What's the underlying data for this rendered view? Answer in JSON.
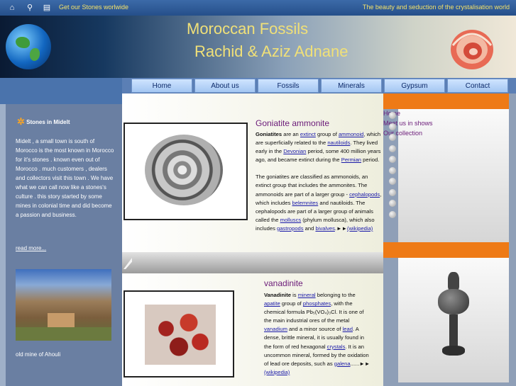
{
  "topbar": {
    "icons": [
      "home-icon",
      "search-icon",
      "document-icon"
    ],
    "tagline_left": "Get our Stones worlwide",
    "tagline_right": "The beauty and seduction of the crystalisation world"
  },
  "banner": {
    "title_line1": "Moroccan Fossils",
    "title_line2": "Rachid & Aziz Adnane"
  },
  "nav": {
    "items": [
      {
        "label": "Home"
      },
      {
        "label": "About us"
      },
      {
        "label": "Fossils"
      },
      {
        "label": "Minerals"
      },
      {
        "label": "Gypsum"
      },
      {
        "label": "Contact"
      }
    ]
  },
  "sidebar": {
    "heading": "Stones in Midelt",
    "text": "Midelt , a small town is south of Morocco is the most known in Morocco for it's stones . known even out of Morocco . much customers , dealers and collectors visit this town . We have what we can call now like a stones's culture . this story started by some mines in colonial time and did become a passion and business.",
    "read_more": "read more...",
    "photo_caption": "old mine of Ahouli"
  },
  "articles": {
    "goniatite": {
      "title": "Goniatite ammonite",
      "p1": [
        {
          "t": "Goniatites",
          "b": true
        },
        {
          "t": " are an "
        },
        {
          "t": "extinct",
          "link": true
        },
        {
          "t": " group of "
        },
        {
          "t": "ammonoid",
          "link": true
        },
        {
          "t": ", which are superficially related to the "
        },
        {
          "t": "nautiloids",
          "link": true
        },
        {
          "t": ". They lived early in the "
        },
        {
          "t": "Devonian",
          "link": true
        },
        {
          "t": " period, some 400 million years ago, and became extinct during the "
        },
        {
          "t": "Permian",
          "link": true
        },
        {
          "t": " period."
        }
      ],
      "p2": [
        {
          "t": "The goniatites are classified as ammonoids, an extinct group that includes the ammonites. The ammonoids are part of a larger group - "
        },
        {
          "t": "cephalopods",
          "link": true
        },
        {
          "t": ", which includes "
        },
        {
          "t": "belemnites",
          "link": true
        },
        {
          "t": " and nautiloids. The cephalopods are part of a larger group of animals called the "
        },
        {
          "t": "molluscs",
          "link": true
        },
        {
          "t": " (phylum mollusca), which also includes "
        },
        {
          "t": "gastropods",
          "link": true
        },
        {
          "t": " and "
        },
        {
          "t": "bivalves",
          "link": true
        },
        {
          "t": ".►►"
        },
        {
          "t": "(wikipedia)",
          "link": true
        }
      ]
    },
    "vanadinite": {
      "title": "vanadinite",
      "p1": [
        {
          "t": "Vanadinite",
          "b": true
        },
        {
          "t": " is "
        },
        {
          "t": "mineral",
          "link": true
        },
        {
          "t": " belonging to the "
        },
        {
          "t": "apatite",
          "link": true
        },
        {
          "t": " group of "
        },
        {
          "t": "phosphates",
          "link": true
        },
        {
          "t": ", with the chemical formula Pb₅(VO₄)₃Cl. It is one of the main industrial ores of the metal "
        },
        {
          "t": "vanadium",
          "link": true
        },
        {
          "t": " and a minor source of "
        },
        {
          "t": "lead",
          "link": true
        },
        {
          "t": ". A dense, brittle mineral, it is usually found in the form of red hexagonal "
        },
        {
          "t": "crystals",
          "link": true
        },
        {
          "t": ". It is an uncommon mineral, formed by the oxidation of lead ore deposits, such as "
        },
        {
          "t": "galena",
          "link": true
        },
        {
          "t": "......►► "
        },
        {
          "t": "(wikipedia)",
          "link": true
        }
      ]
    }
  },
  "right": {
    "links": [
      {
        "label": "Home"
      },
      {
        "label": "Meet us in shows"
      },
      {
        "label": "Our collection"
      }
    ],
    "bullet_count": 10
  },
  "colors": {
    "accent_orange": "#ee7a16",
    "title_purple": "#6a1a78",
    "nav_blue": "#5b7fb5",
    "banner_text": "#f0e078"
  }
}
